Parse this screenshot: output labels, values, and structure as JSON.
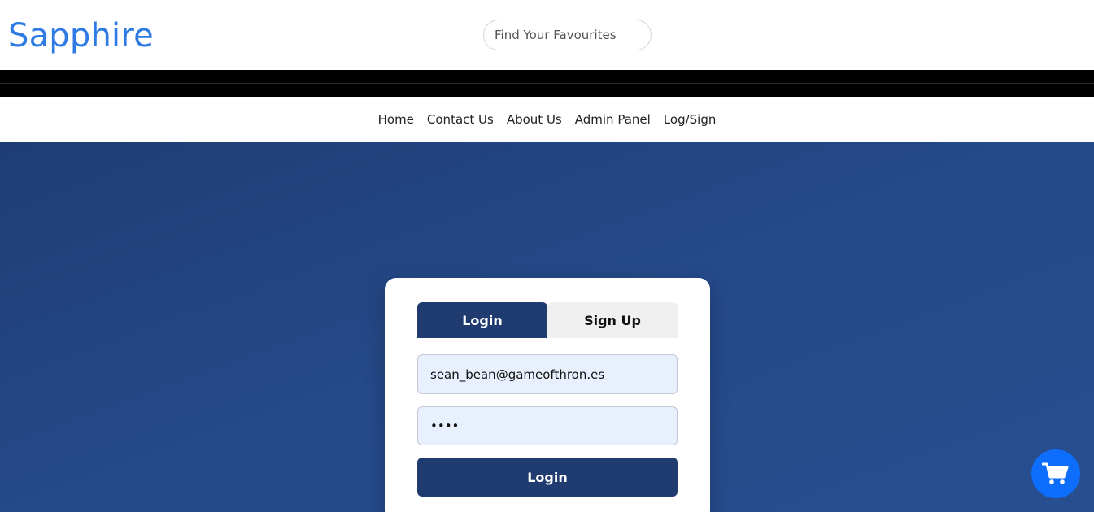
{
  "brand": {
    "name": "Sapphire",
    "color": "#2f7be5"
  },
  "search": {
    "placeholder": "Find Your Favourites"
  },
  "nav": {
    "items": [
      {
        "label": "Home"
      },
      {
        "label": "Contact Us"
      },
      {
        "label": "About Us"
      },
      {
        "label": "Admin Panel"
      },
      {
        "label": "Log/Sign"
      }
    ]
  },
  "auth": {
    "tabs": [
      {
        "label": "Login",
        "active": true
      },
      {
        "label": "Sign Up",
        "active": false
      }
    ],
    "email_value": "sean_bean@gameofthron.es",
    "password_value": "••••",
    "submit_label": "Login"
  },
  "cart": {
    "icon": "shopping-cart-icon",
    "color": "#0d6efd"
  },
  "colors": {
    "hero": "#244784",
    "primary": "#1f3b6f"
  }
}
